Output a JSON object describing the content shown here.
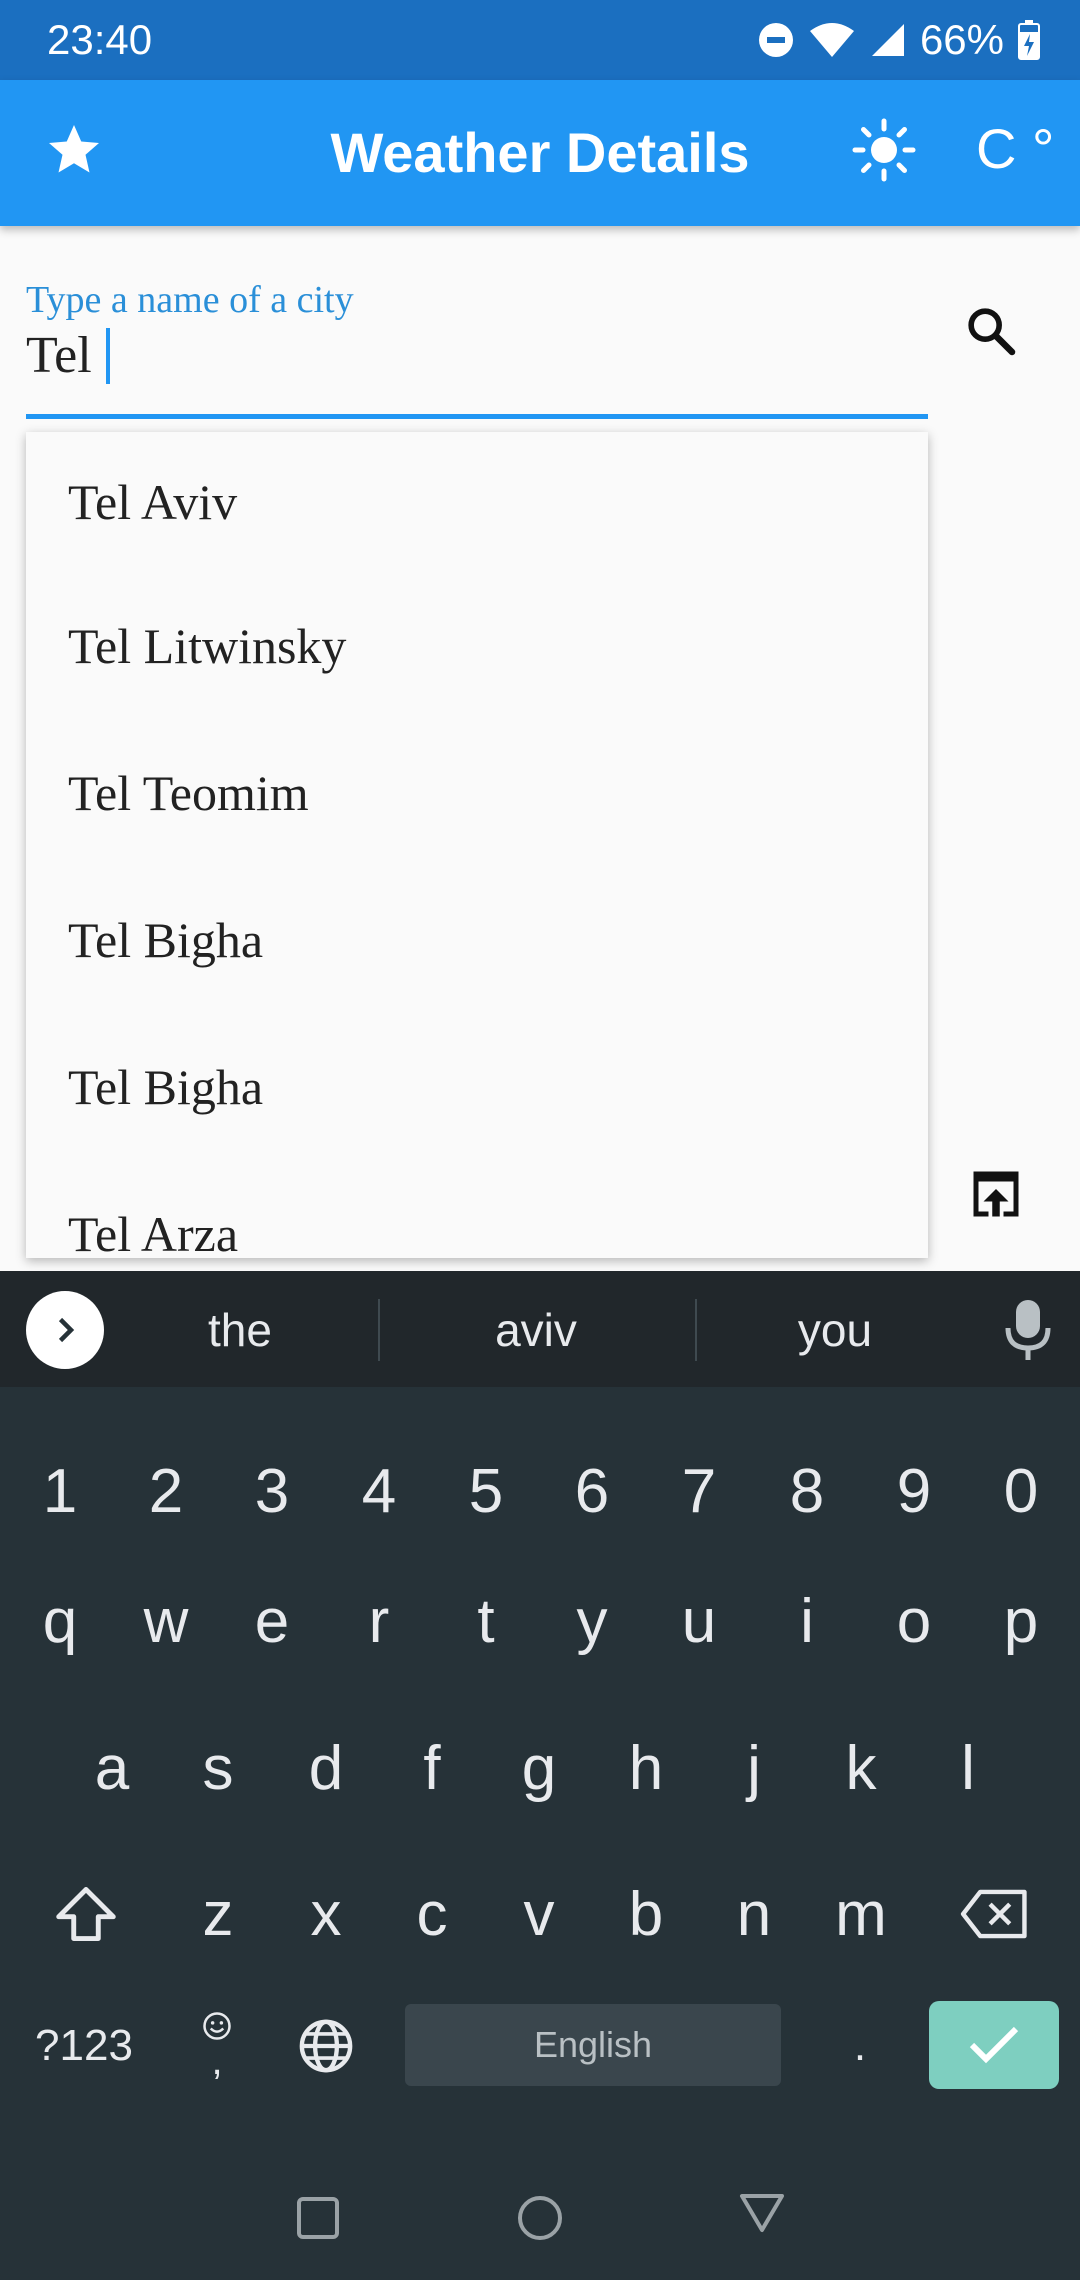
{
  "status_bar": {
    "time": "23:40",
    "battery_percent": "66%"
  },
  "app_bar": {
    "title": "Weather Details",
    "unit": "C °"
  },
  "search": {
    "label": "Type a name of a city",
    "value": "Tel"
  },
  "suggestions_dropdown": {
    "items": [
      "Tel Aviv",
      "Tel Litwinsky",
      "Tel Teomim",
      "Tel Bigha",
      "Tel Bigha",
      "Tel Arza"
    ]
  },
  "keyboard": {
    "suggestions": [
      "the",
      "aviv",
      "you"
    ],
    "number_row": [
      "1",
      "2",
      "3",
      "4",
      "5",
      "6",
      "7",
      "8",
      "9",
      "0"
    ],
    "row1": [
      "q",
      "w",
      "e",
      "r",
      "t",
      "y",
      "u",
      "i",
      "o",
      "p"
    ],
    "row2": [
      "a",
      "s",
      "d",
      "f",
      "g",
      "h",
      "j",
      "k",
      "l"
    ],
    "row3": [
      "z",
      "x",
      "c",
      "v",
      "b",
      "n",
      "m"
    ],
    "symbols_key": "?123",
    "comma_key": ",",
    "period_key": ".",
    "space_label": "English"
  },
  "colors": {
    "primary": "#2196f3",
    "status_bar": "#1b6fc0",
    "accent_text": "#2a8fd8",
    "keyboard_bg": "#263238",
    "enter_key": "#7ecfc0"
  }
}
